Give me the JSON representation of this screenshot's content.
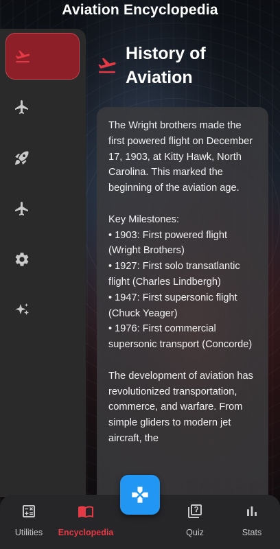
{
  "app": {
    "title": "Aviation Encyclopedia"
  },
  "sidebar": {
    "items": [
      {
        "icon": "flight-takeoff-icon",
        "active": true
      },
      {
        "icon": "airplane-icon",
        "active": false
      },
      {
        "icon": "rocket-icon",
        "active": false
      },
      {
        "icon": "airplane-icon",
        "active": false
      },
      {
        "icon": "gear-icon",
        "active": false
      },
      {
        "icon": "sparkle-icon",
        "active": false
      }
    ]
  },
  "section": {
    "icon": "flight-takeoff-icon",
    "title": "History of Aviation"
  },
  "content": {
    "intro": "The Wright brothers made the first powered flight on December 17, 1903, at Kitty Hawk, North Carolina. This marked the beginning of the aviation age.",
    "milestones_heading": "Key Milestones:",
    "milestones": [
      "• 1903: First powered flight (Wright Brothers)",
      "• 1927: First solo transatlantic flight (Charles Lindbergh)",
      "• 1947: First supersonic flight (Chuck Yeager)",
      "• 1976: First commercial supersonic transport (Concorde)"
    ],
    "closing": "The development of aviation has revolutionized transportation, commerce, and warfare. From simple gliders to modern jet aircraft, the"
  },
  "bottom_nav": {
    "tabs": [
      {
        "label": "Utilities",
        "icon": "calculator-icon",
        "active": false
      },
      {
        "label": "Encyclopedia",
        "icon": "book-icon",
        "active": true
      },
      {
        "label": "Quiz",
        "icon": "quiz-icon",
        "active": false
      },
      {
        "label": "Stats",
        "icon": "bar-chart-icon",
        "active": false
      }
    ],
    "fab_icon": "gamepad-icon"
  },
  "colors": {
    "accent_red": "#e53945",
    "active_bg": "#8c1f28",
    "fab_blue": "#2196f3"
  }
}
